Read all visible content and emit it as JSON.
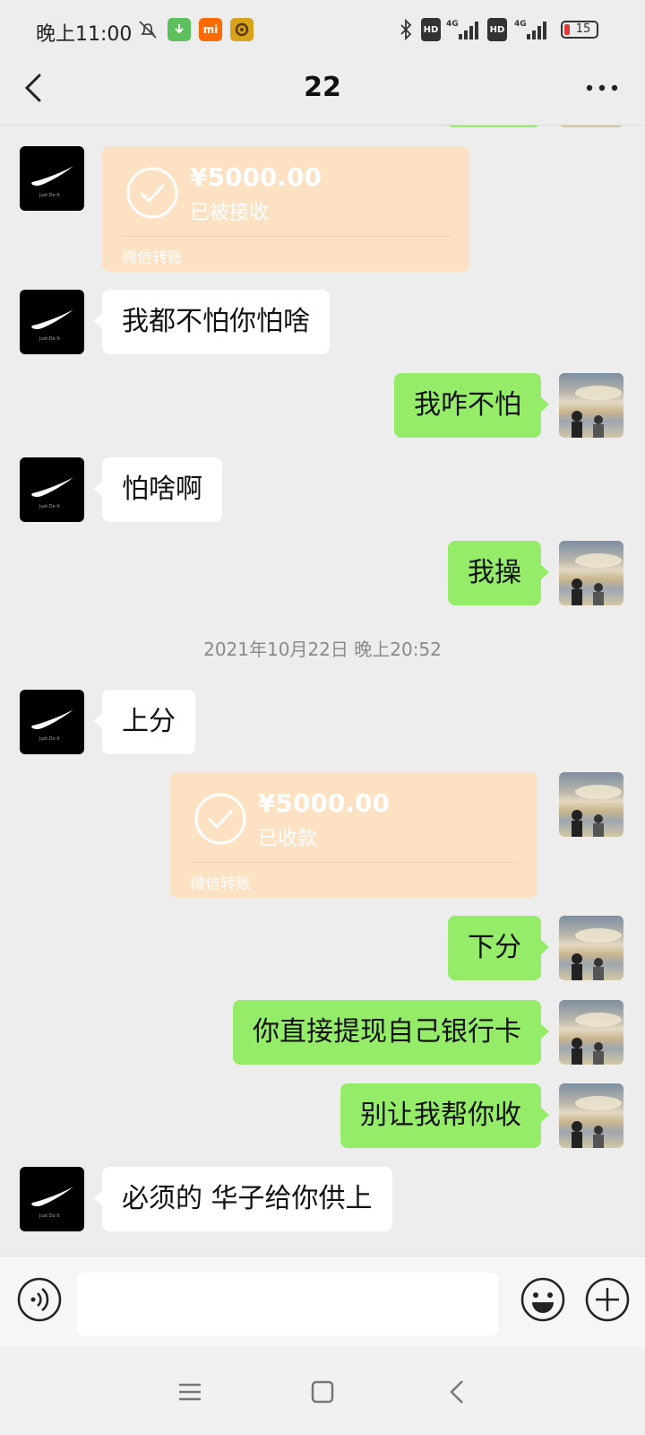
{
  "status_bar": {
    "time": "晚上11:00",
    "icons": [
      "mute-bell-icon",
      "download-icon",
      "mi-icon",
      "app-icon",
      "bluetooth-icon",
      "hd-icon",
      "signal-icon",
      "hd-icon",
      "signal-icon",
      "battery-icon"
    ],
    "hd_label": "HD",
    "network_label": "4G",
    "battery": "15",
    "mi_label": "mi"
  },
  "header": {
    "title": "22"
  },
  "messages": {
    "transfer1": {
      "amount": "¥5000.00",
      "status": "已被接收",
      "label": "微信转账"
    },
    "m1": "我都不怕你怕啥",
    "m2": "我咋不怕",
    "m3": "怕啥啊",
    "m4": "我操",
    "timestamp": "2021年10月22日 晚上20:52",
    "m5": "上分",
    "transfer2": {
      "amount": "¥5000.00",
      "status": "已收款",
      "label": "微信转账"
    },
    "m6": "下分",
    "m7": "你直接提现自己银行卡",
    "m8": "别让我帮你收",
    "m9": "必须的 华子给你供上"
  },
  "avatar_text": "Just Do It",
  "colors": {
    "bubble_right": "#95ec69",
    "bubble_left": "#ffffff",
    "transfer": "#fde1c3",
    "background": "#ededed"
  }
}
